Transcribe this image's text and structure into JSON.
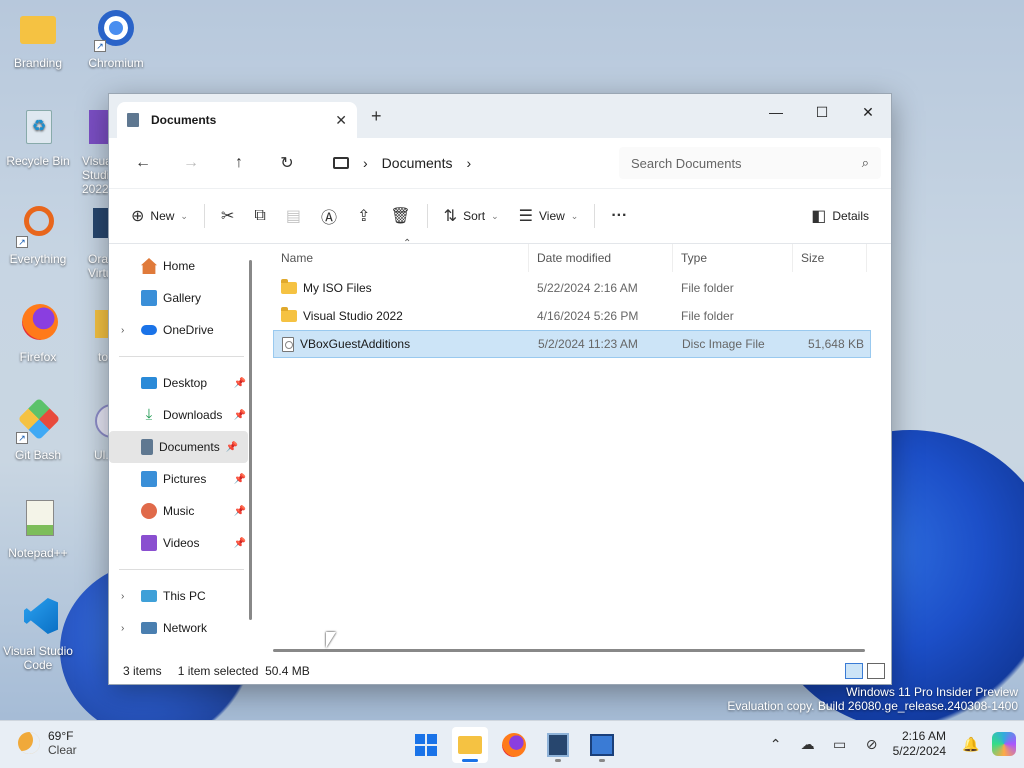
{
  "desktop": {
    "icons": [
      {
        "label": "Branding"
      },
      {
        "label": "Chromium"
      },
      {
        "label": "Recycle Bin"
      },
      {
        "label": "Visual Studio 2022"
      },
      {
        "label": "Everything"
      },
      {
        "label": "Oracle VirtualBox"
      },
      {
        "label": "Firefox"
      },
      {
        "label": "to..."
      },
      {
        "label": "Git Bash"
      },
      {
        "label": "Ul..."
      },
      {
        "label": "Notepad++"
      },
      {
        "label": "Visual Studio Code"
      }
    ]
  },
  "window": {
    "tab_title": "Documents",
    "address": {
      "crumb": "Documents"
    },
    "search_placeholder": "Search Documents",
    "commands": {
      "new": "New",
      "sort": "Sort",
      "view": "View",
      "details": "Details"
    },
    "nav": {
      "home": "Home",
      "gallery": "Gallery",
      "onedrive": "OneDrive",
      "desktop": "Desktop",
      "downloads": "Downloads",
      "documents": "Documents",
      "pictures": "Pictures",
      "music": "Music",
      "videos": "Videos",
      "thispc": "This PC",
      "network": "Network"
    },
    "columns": {
      "name": "Name",
      "date": "Date modified",
      "type": "Type",
      "size": "Size"
    },
    "files": [
      {
        "name": "My ISO Files",
        "date": "5/22/2024 2:16 AM",
        "type": "File folder",
        "size": ""
      },
      {
        "name": "Visual Studio 2022",
        "date": "4/16/2024 5:26 PM",
        "type": "File folder",
        "size": ""
      },
      {
        "name": "VBoxGuestAdditions",
        "date": "5/2/2024 11:23 AM",
        "type": "Disc Image File",
        "size": "51,648 KB"
      }
    ],
    "status": {
      "items": "3 items",
      "selected": "1 item selected",
      "size": "50.4 MB"
    }
  },
  "watermark": {
    "line1": "Windows 11 Pro Insider Preview",
    "line2": "Evaluation copy. Build 26080.ge_release.240308-1400"
  },
  "taskbar": {
    "weather_temp": "69°F",
    "weather_desc": "Clear",
    "time": "2:16 AM",
    "date": "5/22/2024"
  },
  "colors": {
    "accent": "#1a73e8",
    "selection": "#cce4f7"
  }
}
